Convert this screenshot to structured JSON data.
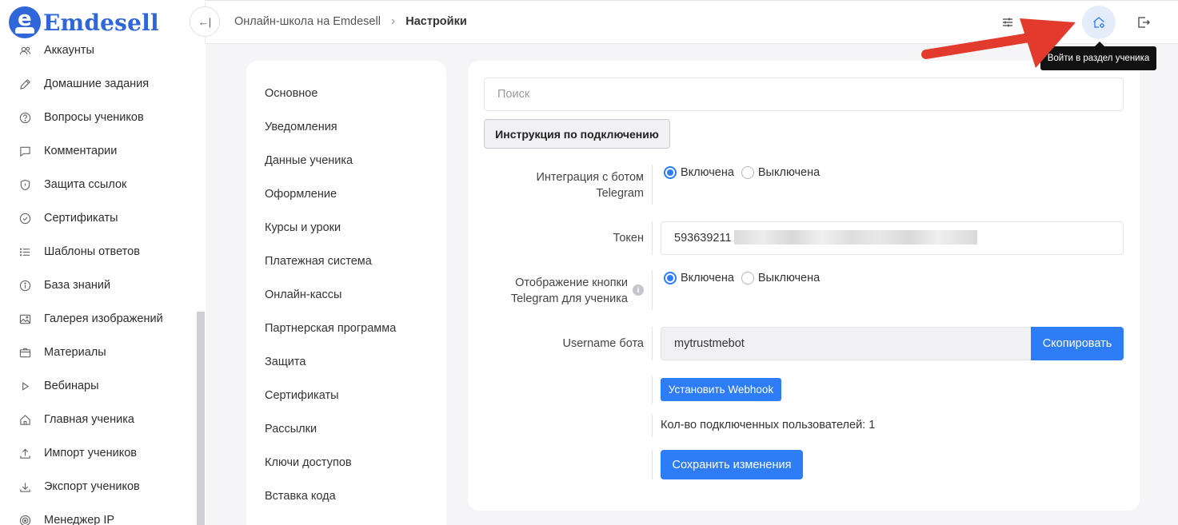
{
  "brand": {
    "name": "Emdesell",
    "logo_letter": "e"
  },
  "sidebar": {
    "items": [
      {
        "label": "Аккаунты",
        "icon": "users-icon"
      },
      {
        "label": "Домашние задания",
        "icon": "pencil-icon"
      },
      {
        "label": "Вопросы учеников",
        "icon": "question-icon"
      },
      {
        "label": "Комментарии",
        "icon": "comment-icon"
      },
      {
        "label": "Защита ссылок",
        "icon": "shield-icon"
      },
      {
        "label": "Сертификаты",
        "icon": "badge-check-icon"
      },
      {
        "label": "Шаблоны ответов",
        "icon": "list-icon"
      },
      {
        "label": "База знаний",
        "icon": "info-icon"
      },
      {
        "label": "Галерея изображений",
        "icon": "image-icon"
      },
      {
        "label": "Материалы",
        "icon": "box-icon"
      },
      {
        "label": "Вебинары",
        "icon": "play-icon"
      },
      {
        "label": "Главная ученика",
        "icon": "home-icon"
      },
      {
        "label": "Импорт учеников",
        "icon": "upload-icon"
      },
      {
        "label": "Экспорт учеников",
        "icon": "download-icon"
      },
      {
        "label": "Менеджер IP",
        "icon": "target-icon"
      }
    ]
  },
  "header": {
    "collapse_glyph": "←|",
    "breadcrumb": {
      "parent": "Онлайн-школа на Emdesell",
      "separator": "›",
      "current": "Настройки"
    },
    "tooltip": "Войти в раздел ученика"
  },
  "settings_menu": {
    "items": [
      "Основное",
      "Уведомления",
      "Данные ученика",
      "Оформление",
      "Курсы и уроки",
      "Платежная система",
      "Онлайн-кассы",
      "Партнерская программа",
      "Защита",
      "Сертификаты",
      "Рассылки",
      "Ключи доступов",
      "Вставка кода"
    ]
  },
  "content": {
    "search_placeholder": "Поиск",
    "instruction_button": "Инструкция по подключению",
    "integration": {
      "label_line1": "Интеграция с ботом",
      "label_line2": "Telegram",
      "on": "Включена",
      "off": "Выключена",
      "selected": "on"
    },
    "token": {
      "label": "Токен",
      "value": "593639211"
    },
    "display": {
      "label_line1": "Отображение кнопки",
      "label_line2": "Telegram для ученика",
      "on": "Включена",
      "off": "Выключена",
      "selected": "on"
    },
    "username": {
      "label": "Username бота",
      "value": "mytrustmebot",
      "copy_button": "Скопировать"
    },
    "webhook_button": "Установить Webhook",
    "connected_count": "Кол-во подключенных пользователей: 1",
    "save_button": "Сохранить изменения"
  },
  "colors": {
    "brand": "#2f66d9",
    "primary": "#2e7cf6",
    "arrow": "#e23b2e"
  }
}
